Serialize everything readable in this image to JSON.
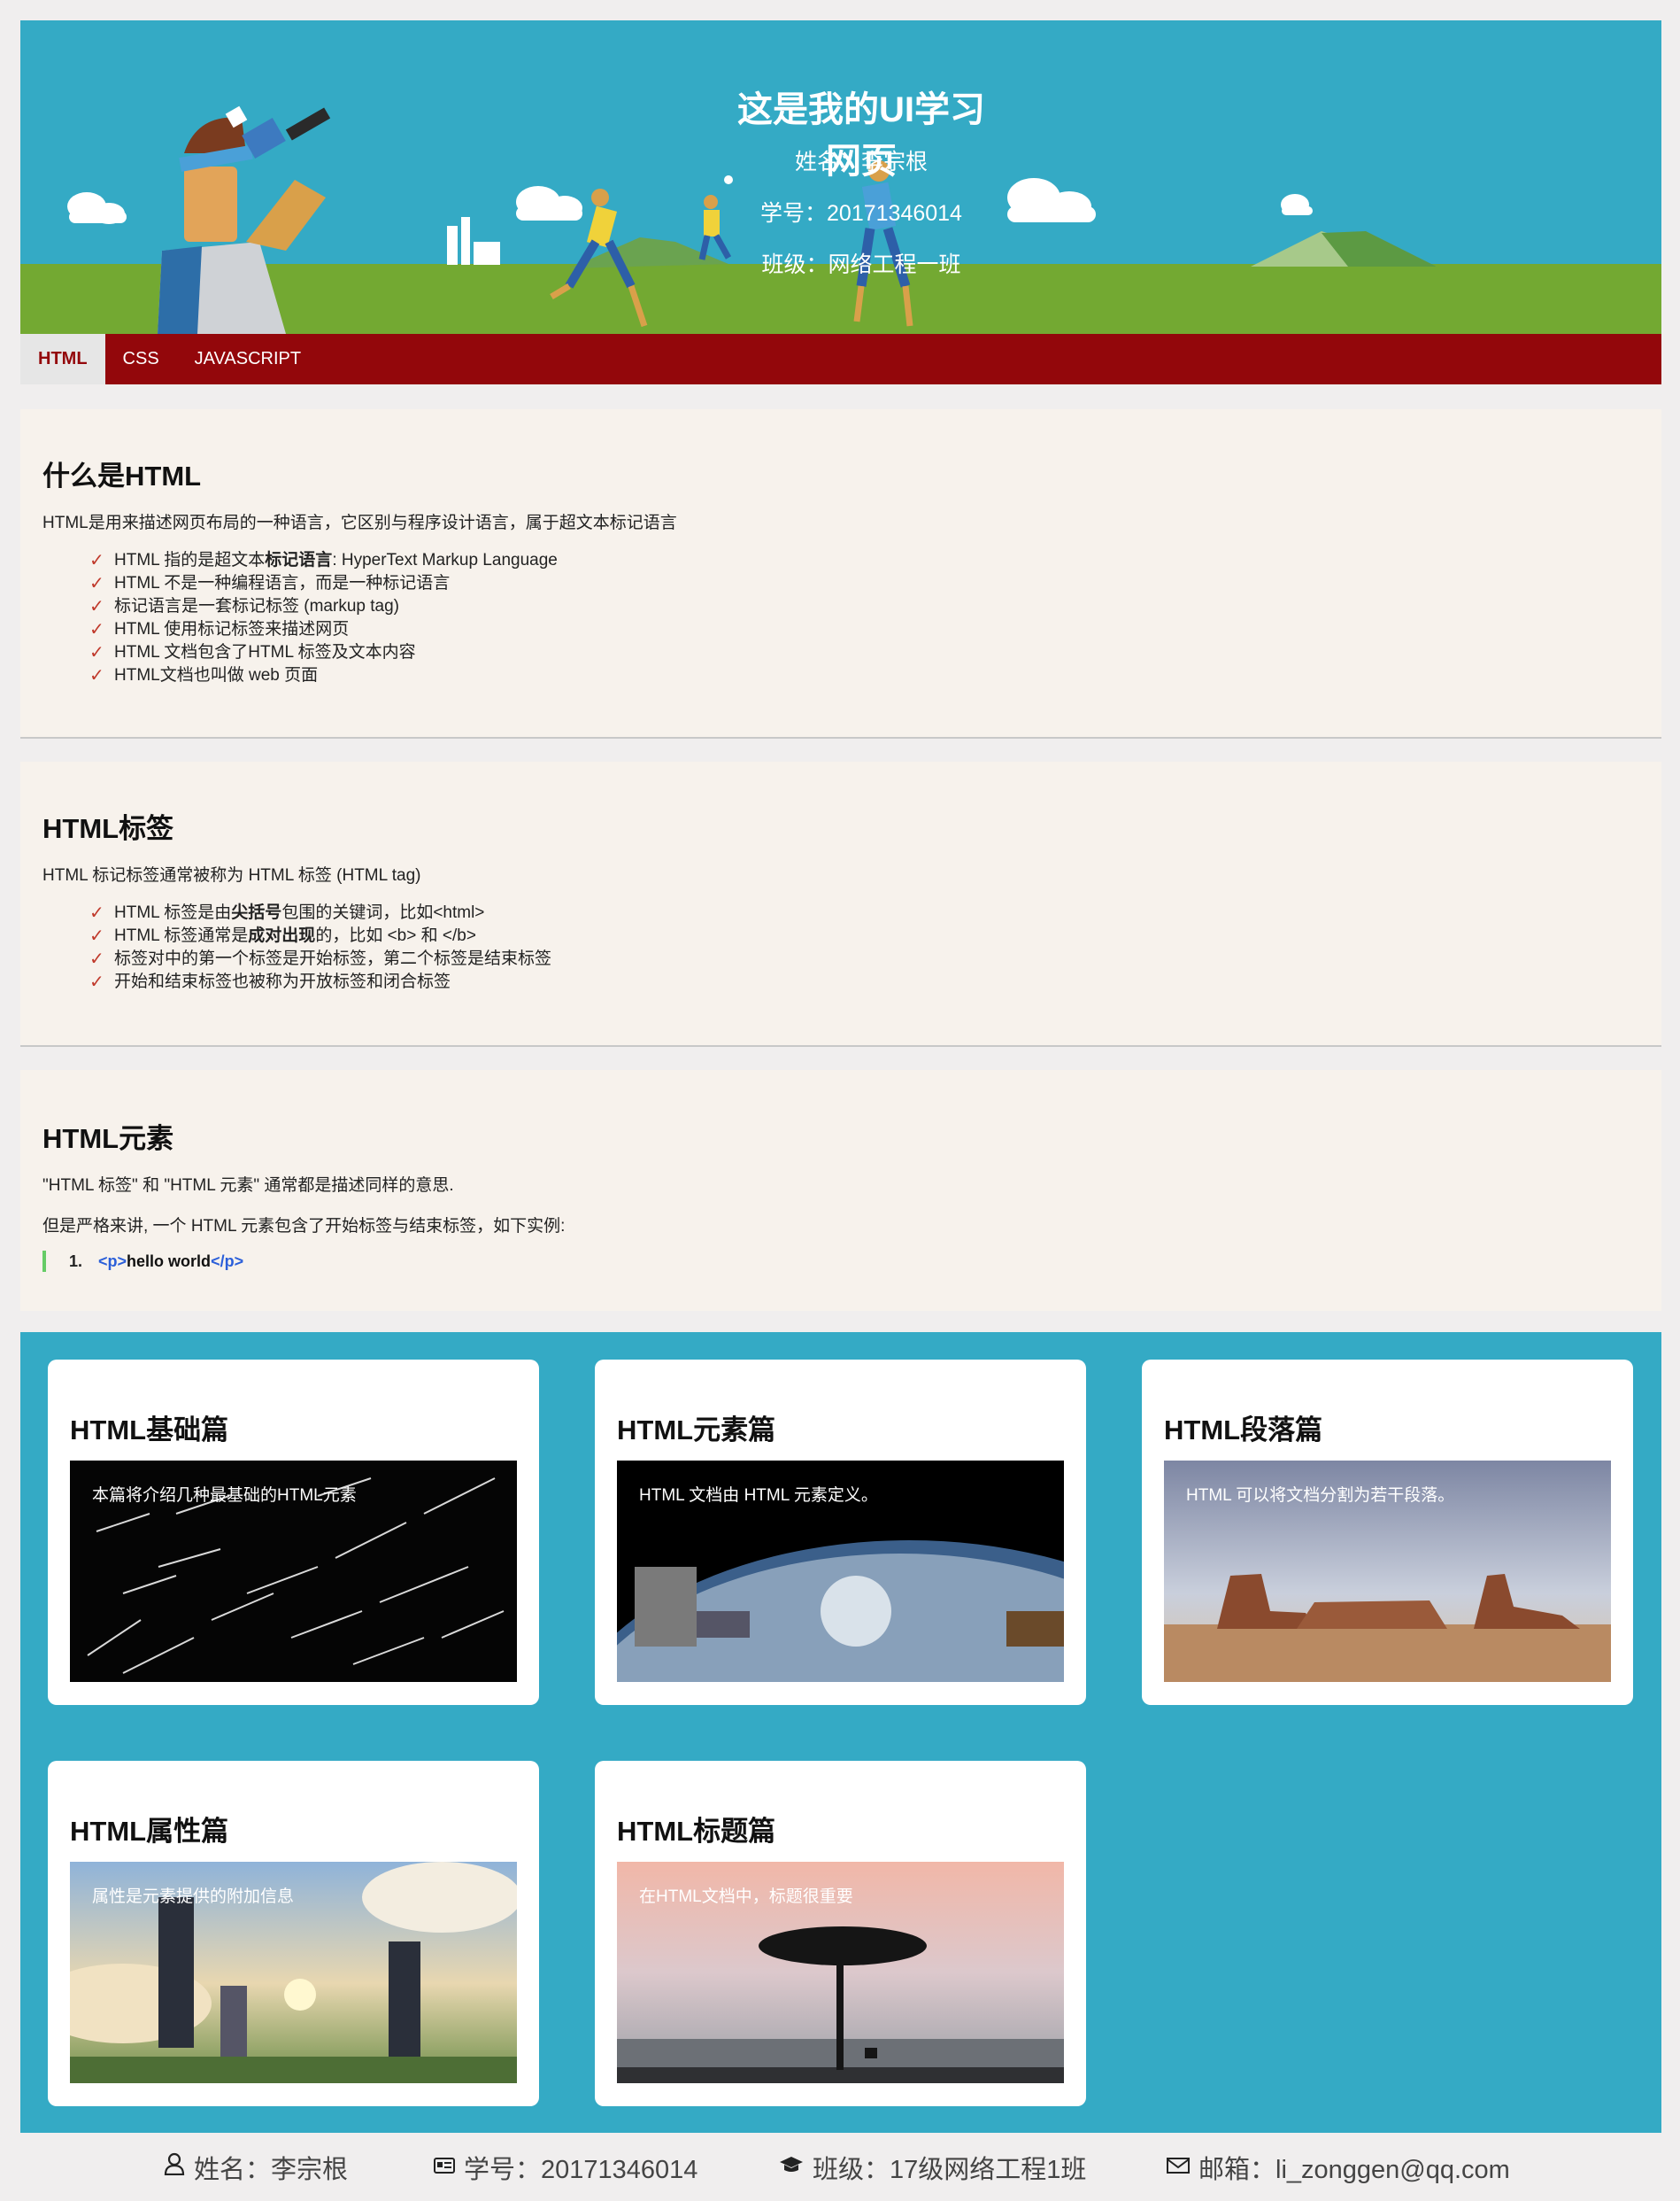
{
  "header": {
    "title": "这是我的UI学习网页",
    "name_line": "姓名：李宗根",
    "id_line": "学号：20171346014",
    "class_line": "班级：网络工程一班"
  },
  "nav": {
    "items": [
      {
        "label": "HTML",
        "active": true
      },
      {
        "label": "CSS",
        "active": false
      },
      {
        "label": "JAVASCRIPT",
        "active": false
      }
    ]
  },
  "section1": {
    "title": "什么是HTML",
    "intro": "HTML是用来描述网页布局的一种语言，它区别与程序设计语言，属于超文本标记语言",
    "items": [
      {
        "pre": "HTML 指的是超文本",
        "bold": "标记语言",
        "post": ": HyperText Markup Language"
      },
      {
        "pre": "HTML 不是一种编程语言，而是一种标记语言",
        "bold": "",
        "post": ""
      },
      {
        "pre": "标记语言是一套标记标签 (markup tag)",
        "bold": "",
        "post": ""
      },
      {
        "pre": "HTML 使用标记标签来描述网页",
        "bold": "",
        "post": ""
      },
      {
        "pre": "HTML 文档包含了HTML 标签及文本内容",
        "bold": "",
        "post": ""
      },
      {
        "pre": "HTML文档也叫做 web 页面",
        "bold": "",
        "post": ""
      }
    ]
  },
  "section2": {
    "title": "HTML标签",
    "intro": "HTML 标记标签通常被称为 HTML 标签 (HTML tag)",
    "items": [
      {
        "pre": "HTML 标签是由",
        "bold": "尖括号",
        "post": "包围的关键词，比如<html>"
      },
      {
        "pre": "HTML 标签通常是",
        "bold": "成对出现",
        "post": "的，比如 <b> 和 </b>"
      },
      {
        "pre": "标签对中的第一个标签是开始标签，第二个标签是结束标签",
        "bold": "",
        "post": ""
      },
      {
        "pre": "开始和结束标签也被称为开放标签和闭合标签",
        "bold": "",
        "post": ""
      }
    ]
  },
  "section3": {
    "title": "HTML元素",
    "p1": "\"HTML 标签\" 和 \"HTML 元素\" 通常都是描述同样的意思.",
    "p2": "但是严格来讲, 一个 HTML 元素包含了开始标签与结束标签，如下实例:",
    "code_num": "1.",
    "code_open": "<p>",
    "code_text": "hello world",
    "code_close": "</p>"
  },
  "cards": [
    {
      "title": "HTML基础篇",
      "caption": "本篇将介绍几种最基础的HTML元素",
      "image": "starfield"
    },
    {
      "title": "HTML元素篇",
      "caption": "HTML 文档由 HTML 元素定义。",
      "image": "earth-orbit"
    },
    {
      "title": "HTML段落篇",
      "caption": "HTML 可以将文档分割为若干段落。",
      "image": "desert-mesa"
    },
    {
      "title": "HTML属性篇",
      "caption": "属性是元素提供的附加信息",
      "image": "anime-sky"
    },
    {
      "title": "HTML标题篇",
      "caption": "在HTML文档中，标题很重要",
      "image": "acacia-sunset"
    }
  ],
  "footer": {
    "name": "姓名：李宗根",
    "id": "学号：20171346014",
    "class": "班级：17级网络工程1班",
    "email": "邮箱：li_zonggen@qq.com"
  },
  "colors": {
    "header_bg": "#34aac5",
    "nav_bg": "#93070b",
    "section_bg": "#f7f2ec",
    "check": "#c0392b"
  }
}
